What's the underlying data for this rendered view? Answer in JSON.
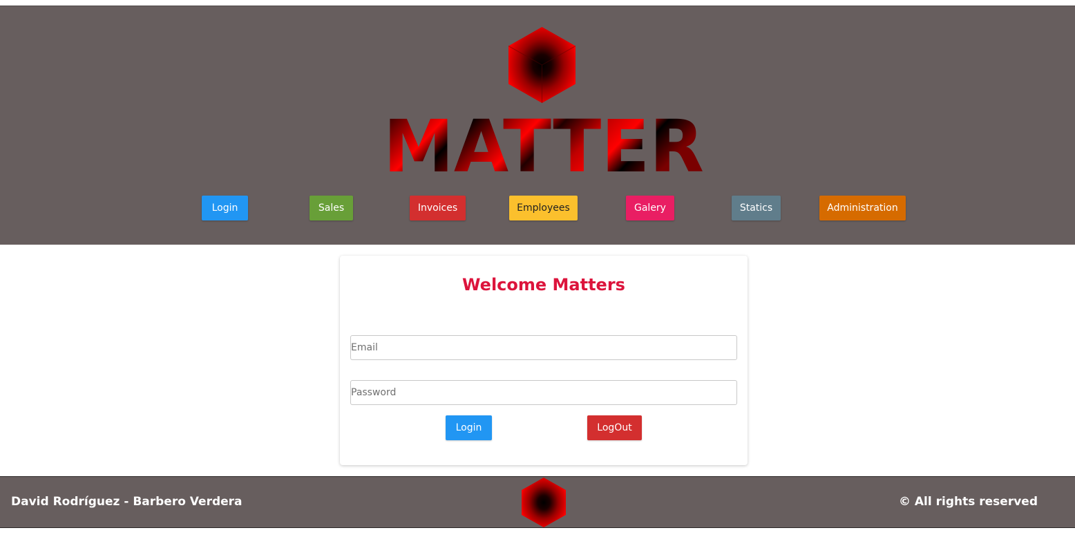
{
  "header": {
    "logo_icon": "hexagon-cube-logo-icon",
    "logo_text": "MATTER",
    "background": "#675e5e"
  },
  "nav": {
    "items": [
      {
        "label": "Login",
        "color": "#2196f3"
      },
      {
        "label": "Sales",
        "color": "#689f38"
      },
      {
        "label": "Invoices",
        "color": "#d32f2f"
      },
      {
        "label": "Employees",
        "color": "#fbc02d"
      },
      {
        "label": "Galery",
        "color": "#e91e63"
      },
      {
        "label": "Statics",
        "color": "#607d8b"
      },
      {
        "label": "Administration",
        "color": "#d66b00"
      }
    ]
  },
  "login_card": {
    "title": "Welcome Matters",
    "title_color": "#dc143c",
    "email": {
      "value": "",
      "placeholder": "Email"
    },
    "password": {
      "value": "",
      "placeholder": "Password"
    },
    "login_label": "Login",
    "logout_label": "LogOut"
  },
  "footer": {
    "left_text": "David Rodríguez - Barbero Verdera",
    "right_text": "© All rights reserved",
    "logo_icon": "hexagon-cube-logo-icon"
  }
}
